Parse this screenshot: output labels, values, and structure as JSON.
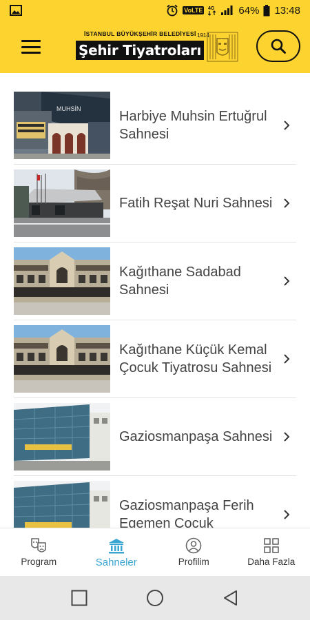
{
  "status_bar": {
    "battery": "64%",
    "time": "13:48",
    "network": "VoLTE"
  },
  "header": {
    "logo_sub": "İSTANBUL BÜYÜKŞEHİR BELEDİYESİ",
    "logo_main": "Şehir Tiyatroları",
    "logo_year": "1914",
    "brand_color": "#fdd330"
  },
  "stages": [
    {
      "name": "Harbiye Muhsin Ertuğrul Sahnesi"
    },
    {
      "name": "Fatih Reşat Nuri Sahnesi"
    },
    {
      "name": "Kağıthane Sadabad Sahnesi"
    },
    {
      "name": "Kağıthane Küçük Kemal Çocuk Tiyatrosu Sahnesi"
    },
    {
      "name": "Gaziosmanpaşa Sahnesi"
    },
    {
      "name": "Gaziosmanpaşa Ferih Egemen Çocuk"
    }
  ],
  "bottom_nav": {
    "items": [
      {
        "label": "Program",
        "icon": "theater-masks-icon"
      },
      {
        "label": "Sahneler",
        "icon": "building-icon",
        "active": true
      },
      {
        "label": "Profilim",
        "icon": "user-circle-icon"
      },
      {
        "label": "Daha Fazla",
        "icon": "grid-icon"
      }
    ],
    "active_color": "#3aa5d1"
  }
}
